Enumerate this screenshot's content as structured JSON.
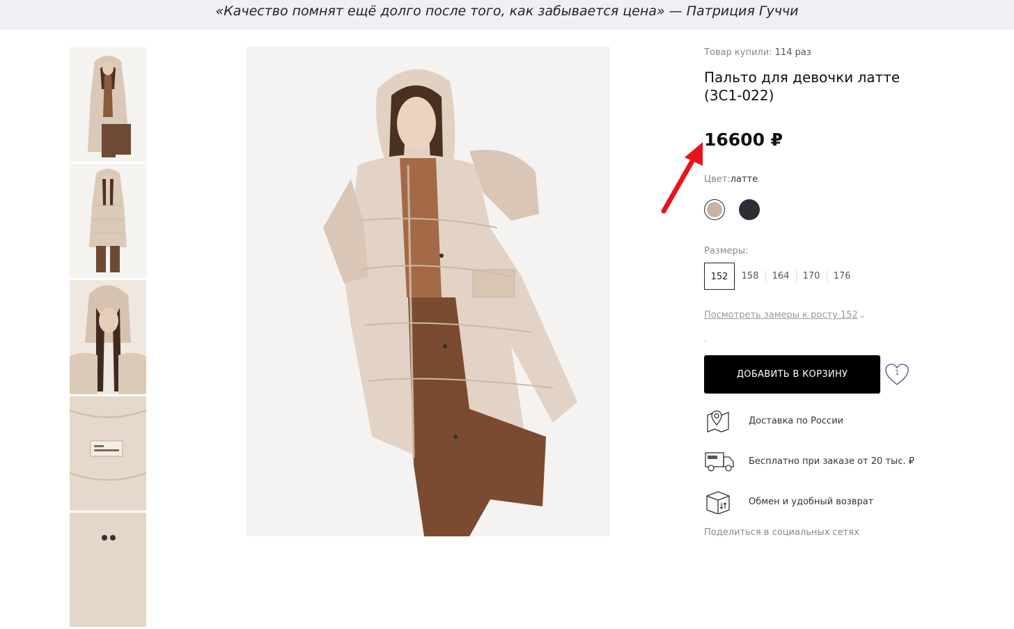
{
  "quote": {
    "text": "«Качество помнят ещё долго после того, как забывается цена»",
    "author": " — Патриция Гуччи"
  },
  "product": {
    "bought_label": "Товар купили: ",
    "bought_count": "114 раз",
    "title": "Пальто для девочки латте (3С1-022)",
    "price": "16600 ₽"
  },
  "color": {
    "label": "Цвет:",
    "value": "латте",
    "swatches": [
      {
        "name": "latte",
        "hex": "#c8b3a3",
        "selected": true
      },
      {
        "name": "dark",
        "hex": "#2b2e35",
        "selected": false
      }
    ]
  },
  "sizes": {
    "label": "Размеры:",
    "items": [
      "152",
      "158",
      "164",
      "170",
      "176"
    ],
    "selected": "152"
  },
  "measure_link": "Посмотреть замеры к росту 152",
  "tiny_dot": ".",
  "add_to_cart": "ДОБАВИТЬ В КОРЗИНУ",
  "favorite_count": "1",
  "features": [
    {
      "icon": "map-pin-icon",
      "text": "Доставка по России"
    },
    {
      "icon": "delivery-truck-icon",
      "text": "Бесплатно при заказе от 20 тыс. ₽"
    },
    {
      "icon": "return-box-icon",
      "text": "Обмен и удобный возврат"
    }
  ],
  "share_label": "Поделиться в социальных сетях",
  "colors": {
    "quote_bg": "#eef0f6",
    "button_bg": "#000000",
    "accent_heart": "#6a6aa8",
    "arrow_red": "#e8141b"
  }
}
